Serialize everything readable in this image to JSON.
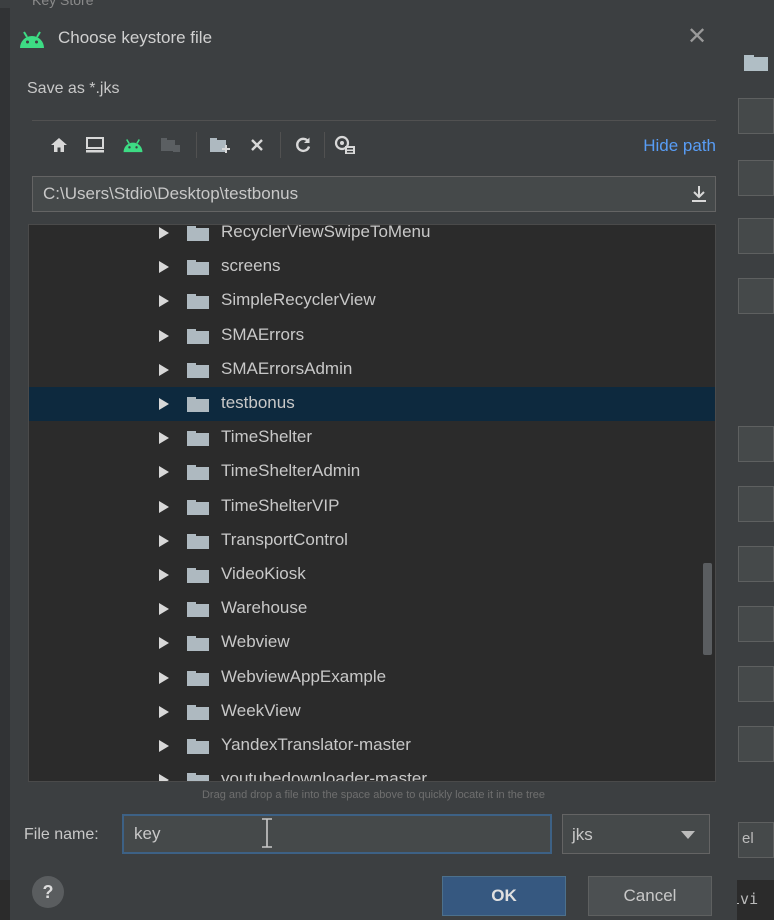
{
  "background": {
    "title_fragment": "Key Store",
    "cutoff_label_1": "el",
    "cutoff_label_2": "tivi"
  },
  "dialog": {
    "title": "Choose keystore file",
    "close_glyph": "✕",
    "subtitle": "Save as *.jks",
    "hide_path_label": "Hide path",
    "path_value": "C:\\Users\\Stdio\\Desktop\\testbonus",
    "toolbar_icons": [
      "home-icon",
      "desktop-icon",
      "android-project-icon",
      "module-icon",
      "new-folder-icon",
      "delete-icon",
      "refresh-icon",
      "show-hidden-icon"
    ]
  },
  "tree": {
    "items": [
      "RecyclerViewSwipeToMenu",
      "screens",
      "SimpleRecyclerView",
      "SMAErrors",
      "SMAErrorsAdmin",
      "testbonus",
      "TimeShelter",
      "TimeShelterAdmin",
      "TimeShelterVIP",
      "TransportControl",
      "VideoKiosk",
      "Warehouse",
      "Webview",
      "WebviewAppExample",
      "WeekView",
      "YandexTranslator-master",
      "youtubedownloader-master"
    ],
    "selected": "testbonus"
  },
  "hint": "Drag and drop a file into the space above to quickly locate it in the tree",
  "file_name": {
    "label": "File name:",
    "value": "key",
    "extension": "jks"
  },
  "buttons": {
    "help": "?",
    "ok": "OK",
    "cancel": "Cancel"
  },
  "colors": {
    "dialog_bg": "#3c3f41",
    "tree_bg": "#2b2b2b",
    "selection": "#0d293e",
    "link": "#589df6",
    "android_green": "#3ddc84",
    "ok_button": "#365880"
  }
}
